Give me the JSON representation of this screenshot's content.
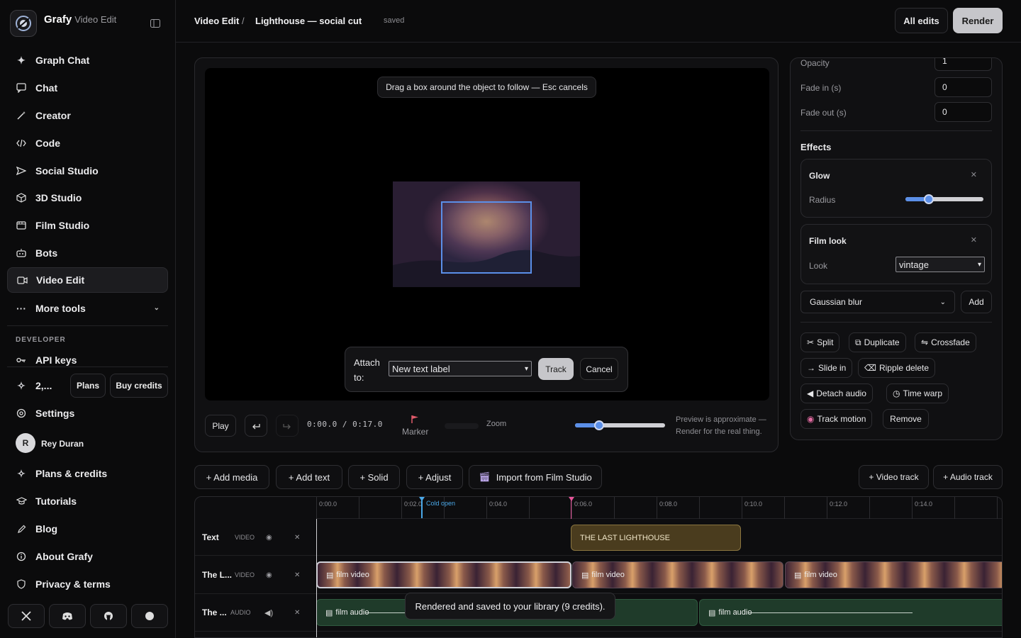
{
  "app": {
    "brand": "Grafy",
    "section": "Video Edit"
  },
  "nav": {
    "items": [
      {
        "label": "Graph Chat",
        "icon": "sparkle-icon"
      },
      {
        "label": "Chat",
        "icon": "chat-icon"
      },
      {
        "label": "Creator",
        "icon": "wand-icon"
      },
      {
        "label": "Code",
        "icon": "code-icon"
      },
      {
        "label": "Social Studio",
        "icon": "send-icon"
      },
      {
        "label": "3D Studio",
        "icon": "cube-icon"
      },
      {
        "label": "Film Studio",
        "icon": "film-icon"
      },
      {
        "label": "Bots",
        "icon": "bot-icon"
      },
      {
        "label": "Video Edit",
        "icon": "video-icon",
        "active": true
      },
      {
        "label": "More tools",
        "icon": "dots-icon"
      }
    ],
    "developer_label": "DEVELOPER",
    "api_keys": "API keys",
    "credits_count": "2,...",
    "plans_btn": "Plans",
    "buy_credits_btn": "Buy credits",
    "settings": "Settings",
    "user_initial": "R",
    "user_name": "Rey Duran",
    "plans_credits": "Plans & credits",
    "tutorials": "Tutorials",
    "blog": "Blog",
    "about": "About Grafy",
    "privacy": "Privacy & terms"
  },
  "header": {
    "crumb_root": "Video Edit",
    "crumb_sep": "/",
    "project": "Lighthouse — social cut",
    "status": "saved",
    "all_edits": "All edits",
    "render": "Render"
  },
  "preview": {
    "hint": "Drag a box around the object to follow — Esc cancels",
    "attach_label": "Attach to:",
    "attach_value": "New text label",
    "track_btn": "Track",
    "cancel_btn": "Cancel",
    "play": "Play",
    "time": "0:00.0 / 0:17.0",
    "marker": "Marker",
    "zoom": "Zoom",
    "zoom_level": 0.27,
    "note_line1": "Preview is approximate —",
    "note_line2": "Render for the real thing."
  },
  "props": {
    "opacity_label": "Opacity",
    "opacity": "1",
    "fadein_label": "Fade in (s)",
    "fadein": "0",
    "fadeout_label": "Fade out (s)",
    "fadeout": "0",
    "effects_title": "Effects",
    "glow": {
      "name": "Glow",
      "param": "Radius",
      "value": 0.3
    },
    "filmlook": {
      "name": "Film look",
      "param": "Look",
      "value": "vintage"
    },
    "effect_select": "Gaussian blur",
    "add_btn": "Add",
    "actions": [
      "Split",
      "Duplicate",
      "Crossfade",
      "Slide in",
      "Ripple delete",
      "Detach audio",
      "Time warp",
      "Track motion",
      "Remove"
    ]
  },
  "toolbar": {
    "add_media": "+ Add media",
    "add_text": "+ Add text",
    "solid": "+ Solid",
    "adjust": "+ Adjust",
    "import": "Import from Film Studio",
    "video_track": "+ Video track",
    "audio_track": "+ Audio track"
  },
  "timeline": {
    "ticks": [
      "0:00.0",
      "0:02.0",
      "0:04.0",
      "0:06.0",
      "0:08.0",
      "0:10.0",
      "0:12.0",
      "0:14.0"
    ],
    "chapter": "Cold open",
    "tracks": [
      {
        "name": "Text",
        "type": "VIDEO"
      },
      {
        "name": "The L...",
        "type": "VIDEO"
      },
      {
        "name": "The ...",
        "type": "AUDIO"
      }
    ],
    "text_clip": "THE LAST LIGHTHOUSE",
    "video_clip": "film video",
    "audio_clip": "film audio"
  },
  "toast": "Rendered and saved to your library (9 credits).",
  "colors": {
    "accent_blue": "#5b8fe8",
    "playhead": "#e6559a",
    "text_clip": "#4a3c1e",
    "audio_clip": "#1f3b2a"
  }
}
